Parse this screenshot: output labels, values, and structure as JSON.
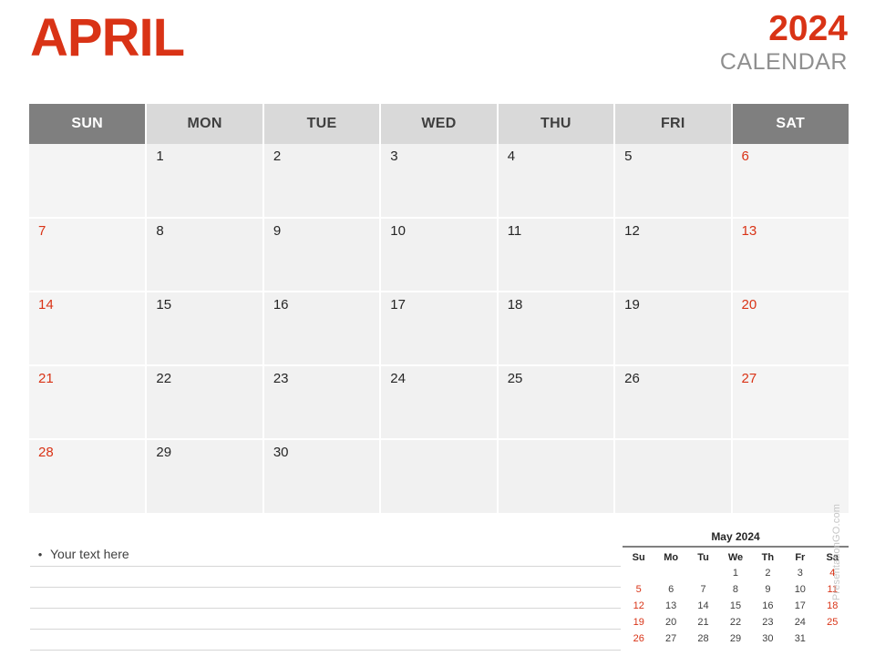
{
  "header": {
    "month": "APRIL",
    "year": "2024",
    "calendar_word": "CALENDAR",
    "accent_color": "#D93316",
    "muted_color": "#8F8F8F"
  },
  "calendar": {
    "weekday_headers": [
      {
        "label": "SUN",
        "weekend": true
      },
      {
        "label": "MON",
        "weekend": false
      },
      {
        "label": "TUE",
        "weekend": false
      },
      {
        "label": "WED",
        "weekend": false
      },
      {
        "label": "THU",
        "weekend": false
      },
      {
        "label": "FRI",
        "weekend": false
      },
      {
        "label": "SAT",
        "weekend": true
      }
    ],
    "weeks": [
      [
        "",
        "1",
        "2",
        "3",
        "4",
        "5",
        "6"
      ],
      [
        "7",
        "8",
        "9",
        "10",
        "11",
        "12",
        "13"
      ],
      [
        "14",
        "15",
        "16",
        "17",
        "18",
        "19",
        "20"
      ],
      [
        "21",
        "22",
        "23",
        "24",
        "25",
        "26",
        "27"
      ],
      [
        "28",
        "29",
        "30",
        "",
        "",
        "",
        ""
      ]
    ]
  },
  "notes": {
    "bullet": "•",
    "text": "Your text here",
    "blank_line_count": 4
  },
  "mini_calendar": {
    "title": "May 2024",
    "weekday_headers": [
      "Su",
      "Mo",
      "Tu",
      "We",
      "Th",
      "Fr",
      "Sa"
    ],
    "weeks": [
      [
        "",
        "",
        "",
        "1",
        "2",
        "3",
        "4"
      ],
      [
        "5",
        "6",
        "7",
        "8",
        "9",
        "10",
        "11"
      ],
      [
        "12",
        "13",
        "14",
        "15",
        "16",
        "17",
        "18"
      ],
      [
        "19",
        "20",
        "21",
        "22",
        "23",
        "24",
        "25"
      ],
      [
        "26",
        "27",
        "28",
        "29",
        "30",
        "31",
        ""
      ]
    ]
  },
  "watermark": {
    "text": "PresentationGO.com"
  }
}
